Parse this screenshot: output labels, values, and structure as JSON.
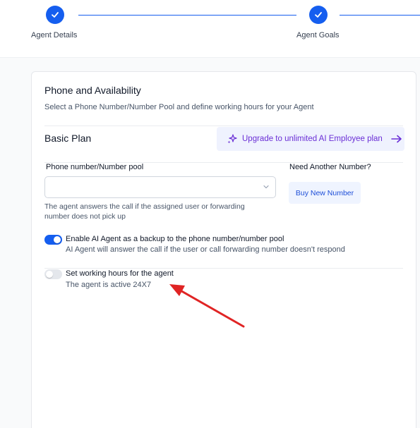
{
  "stepper": {
    "steps": [
      {
        "label": "Agent Details",
        "status": "complete"
      },
      {
        "label": "Agent Goals",
        "status": "complete"
      }
    ],
    "accent": "#155eef"
  },
  "section": {
    "title": "Phone and Availability",
    "subtitle": "Select a Phone Number/Number Pool and define working hours for your Agent"
  },
  "plan": {
    "name": "Basic Plan",
    "upgrade_label": "Upgrade to unlimited AI Employee plan"
  },
  "phone": {
    "label": "Phone number/Number pool",
    "value": "",
    "helper": "The agent answers the call if the assigned user or forwarding number does not pick up"
  },
  "another_number": {
    "label": "Need Another Number?",
    "button_label": "Buy New Number"
  },
  "backup_toggle": {
    "enabled": true,
    "title": "Enable AI Agent as a backup to the phone number/number pool",
    "description": "AI Agent will answer the call if the user or call forwarding number doesn't respond"
  },
  "working_hours_toggle": {
    "enabled": false,
    "title": "Set working hours for the agent",
    "description": "The agent is active 24X7"
  },
  "colors": {
    "primary": "#155eef",
    "upgrade_text": "#6b2fd6",
    "annotation_arrow": "#e02424"
  },
  "icons": [
    "check-icon",
    "sparkles-icon",
    "arrow-right-icon",
    "chevron-down-icon"
  ]
}
